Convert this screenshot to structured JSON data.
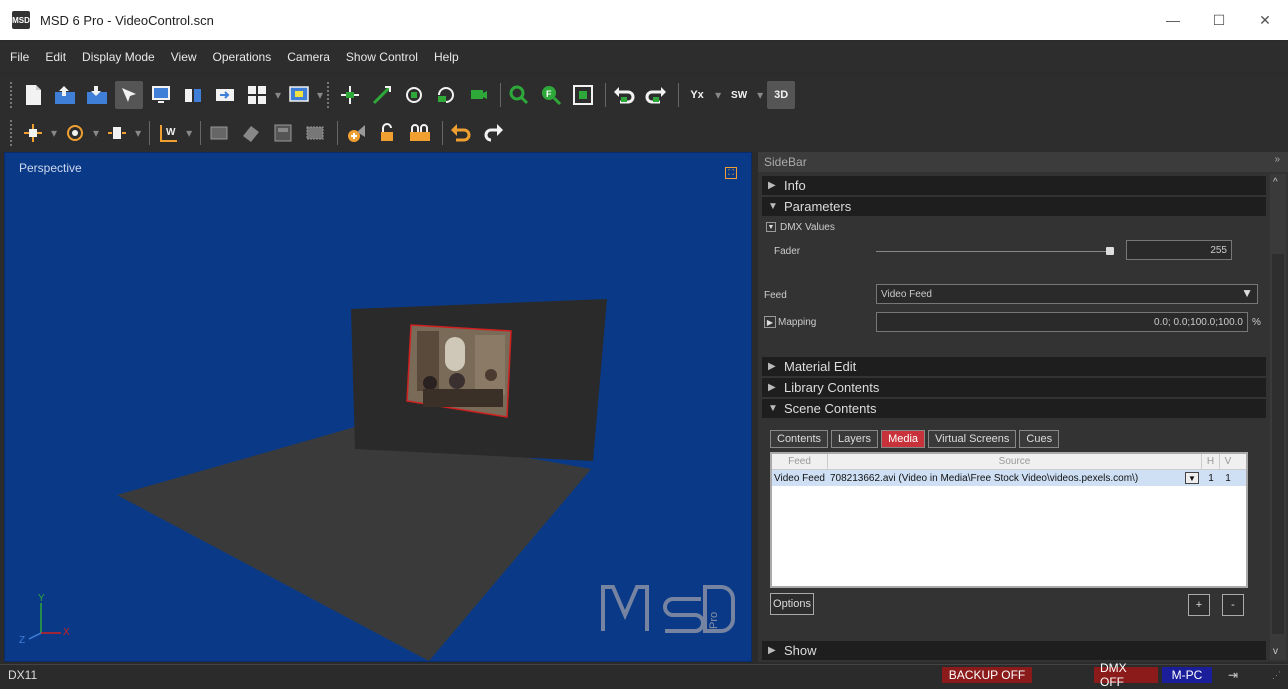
{
  "window": {
    "app_icon_text": "MSD",
    "title": "MSD 6 Pro - VideoControl.scn",
    "minimize": "—",
    "maximize": "☐",
    "close": "✕"
  },
  "menu": [
    "File",
    "Edit",
    "Display Mode",
    "View",
    "Operations",
    "Camera",
    "Show Control",
    "Help"
  ],
  "toolbar": {
    "axis_yx": "Yx",
    "axis_sw": "SW",
    "mode_3d": "3D",
    "world_w": "W",
    "colors": {
      "blue": "#3f7fd8",
      "green": "#2fa83a",
      "white": "#f2f2f2",
      "orange": "#f0a030"
    }
  },
  "viewport": {
    "label": "Perspective",
    "logo_text": "MSD",
    "logo_sub": "Pro",
    "axis_x": "X",
    "axis_y": "Y",
    "axis_z": "Z",
    "bg_color": "#0a3a87"
  },
  "sidebar": {
    "title": "SideBar",
    "sections": {
      "info": "Info",
      "parameters": "Parameters",
      "material_edit": "Material Edit",
      "library_contents": "Library Contents",
      "scene_contents": "Scene Contents",
      "show": "Show"
    },
    "dmx_values": "DMX Values",
    "fader_label": "Fader",
    "fader_value": "255",
    "feed_label": "Feed",
    "feed_value": "Video Feed",
    "mapping_label": "Mapping",
    "mapping_value": "0.0; 0.0;100.0;100.0",
    "mapping_unit": "%",
    "tabs": [
      "Contents",
      "Layers",
      "Media",
      "Virtual Screens",
      "Cues"
    ],
    "active_tab": "Media",
    "table": {
      "headers": [
        "Feed",
        "Source",
        "H",
        "V"
      ],
      "rows": [
        {
          "feed": "Video Feed",
          "source": "708213662.avi (Video in Media\\Free Stock Video\\videos.pexels.com\\)",
          "h": "1",
          "v": "1"
        }
      ]
    },
    "options_button": "Options",
    "add_button": "+",
    "remove_button": "-"
  },
  "status": {
    "renderer": "DX11",
    "backup": "BACKUP OFF",
    "dmx": "DMX OFF",
    "mpc": "M-PC",
    "backup_color": "#8b1a1a",
    "dmx_color": "#8b1a1a",
    "mpc_color": "#1b1e9a"
  }
}
